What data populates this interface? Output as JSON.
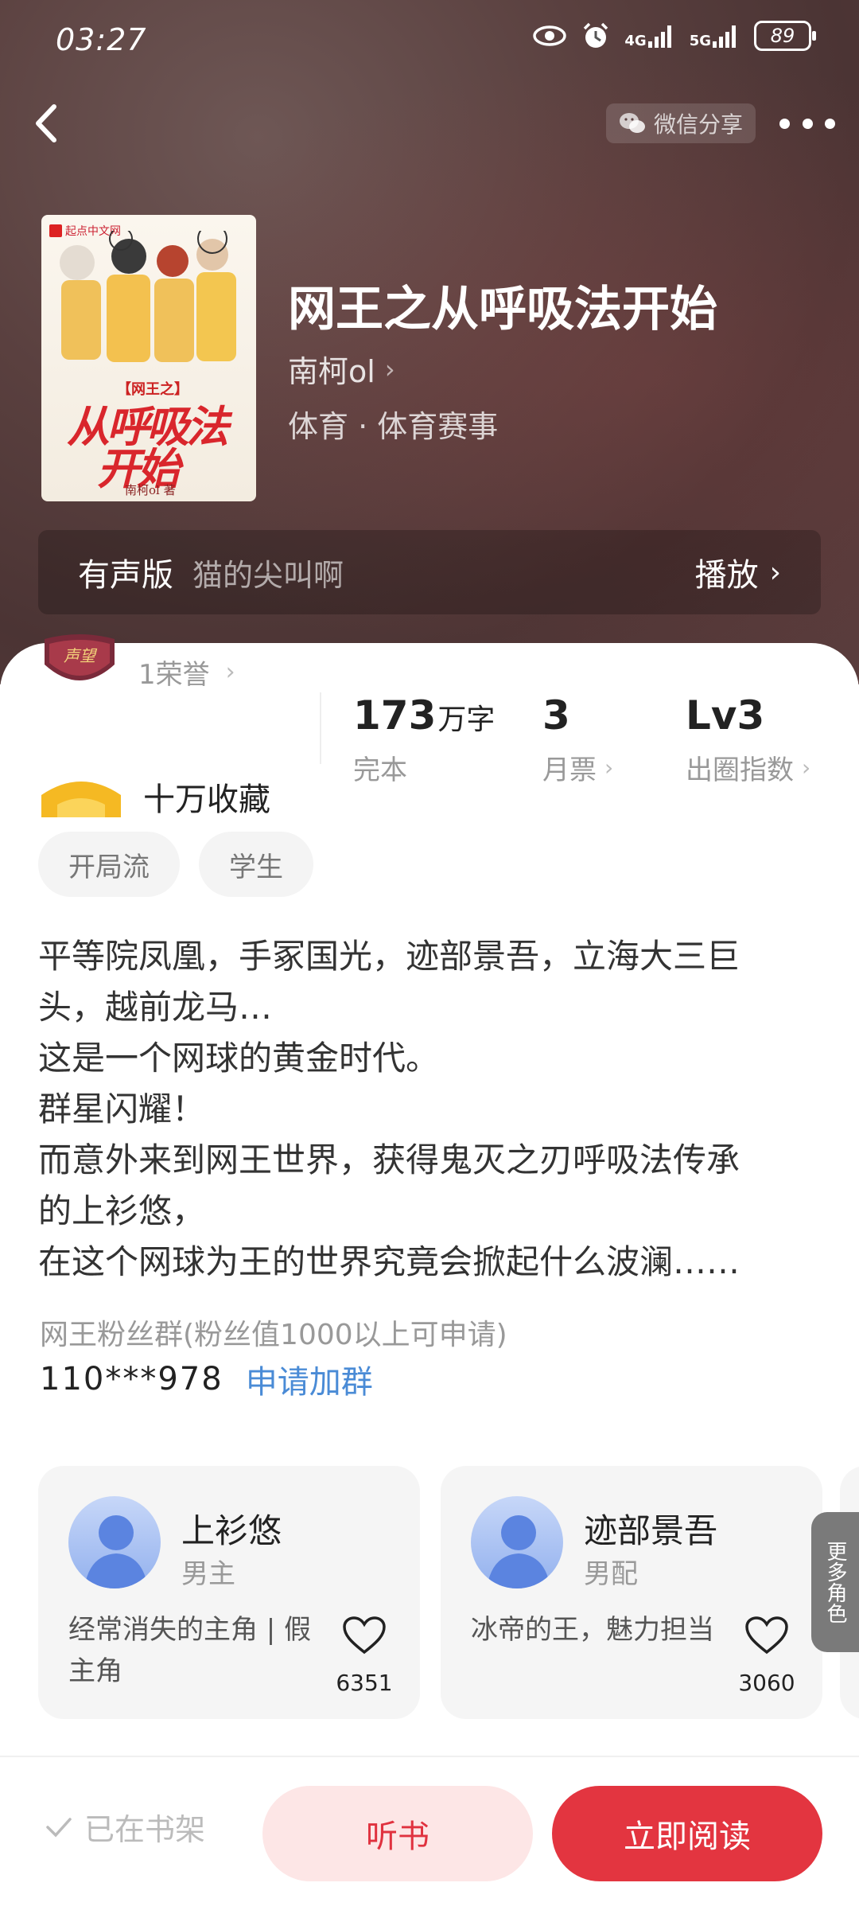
{
  "status_bar": {
    "time": "03:27",
    "battery": "89",
    "network_1": "4G",
    "network_2": "5G"
  },
  "header": {
    "share_label": "微信分享"
  },
  "book": {
    "cover": {
      "brand": "起点中文网",
      "subtitle": "【网王之】",
      "title_line1": "从呼吸法",
      "title_line2": "开始",
      "author": "南柯ol 著"
    },
    "title": "网王之从呼吸法开始",
    "author": "南柯ol",
    "genre": "体育 · 体育赛事"
  },
  "audio": {
    "label": "有声版",
    "narrator": "猫的尖叫啊",
    "play_label": "播放"
  },
  "honor": {
    "badge_text": "声望",
    "text": "1荣誉"
  },
  "stats": [
    {
      "value": "173",
      "unit": "万字",
      "label": "完本"
    },
    {
      "value": "3",
      "unit": "",
      "label": "月票"
    },
    {
      "value": "Lv3",
      "unit": "",
      "label": "出圈指数"
    }
  ],
  "favorites": "十万收藏",
  "tags": [
    "开局流",
    "学生"
  ],
  "description": "平等院凤凰，手冢国光，迹部景吾，立海大三巨\n头，越前龙马…\n这是一个网球的黄金时代。\n群星闪耀！\n而意外来到网王世界，获得鬼灭之刃呼吸法传承\n的上衫悠，\n在这个网球为王的世界究竟会掀起什么波澜……",
  "fan_group": {
    "label": "网王粉丝群(粉丝值1000以上可申请)",
    "number": "110***978",
    "apply_label": "申请加群"
  },
  "roles": [
    {
      "name": "上衫悠",
      "type": "男主",
      "desc": "经常消失的主角 | 假主角",
      "likes": "6351"
    },
    {
      "name": "迹部景吾",
      "type": "男配",
      "desc": "冰帝的王，魅力担当",
      "likes": "3060"
    }
  ],
  "more_roles": "更多角色",
  "bottom": {
    "shelf_label": "已在书架",
    "listen_label": "听书",
    "read_label": "立即阅读"
  },
  "colors": {
    "accent": "#e33540",
    "link": "#4a8bd6",
    "listen_bg": "#fde6e6"
  }
}
